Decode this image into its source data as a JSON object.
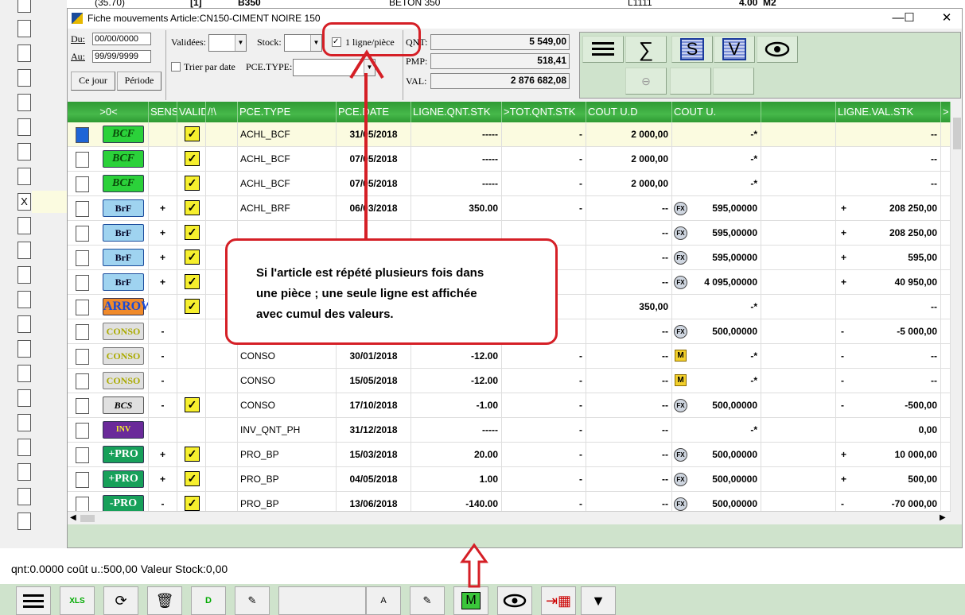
{
  "background": {
    "top_row": {
      "qty": "(35.70)",
      "code": "[1]",
      "name": "B350",
      "desc": "BETON 350",
      "ref": "L1111",
      "val": "4.00",
      "unit": "M2"
    },
    "marked_row_label": "X"
  },
  "window": {
    "title": "Fiche mouvements Article:CN150-CIMENT NOIRE 150",
    "minimize": "—",
    "maximize": "☐",
    "close": "✕"
  },
  "filters": {
    "du_label": "Du:",
    "du_value": "00/00/0000",
    "au_label": "Au:",
    "au_value": "99/99/9999",
    "ce_jour": "Ce jour",
    "periode": "Période",
    "validees_label": "Validées:",
    "stock_label": "Stock:",
    "une_ligne_label": "1 ligne/pièce",
    "une_ligne_checked": true,
    "trier_label": "Trier par date",
    "pce_type_label": "PCE.TYPE:"
  },
  "summary": {
    "qnt_label": "QNT:",
    "qnt_value": "5 549,00",
    "pmp_label": "PMP:",
    "pmp_value": "518,41",
    "val_label": "VAL:",
    "val_value": "2 876 682,08"
  },
  "toolbar": {
    "menu_icon": "hamburger-icon",
    "sum_icon": "sigma-icon",
    "s_label": "S",
    "v_label": "V",
    "eye_icon": "eye-icon",
    "zoom_icon": "zoom-out-icon"
  },
  "grid": {
    "headers": [
      ">0<",
      "SENS",
      "VALID",
      "/!\\",
      "PCE.TYPE",
      "PCE.DATE",
      "LIGNE.QNT.STK",
      ">TOT.QNT.STK",
      "COUT U.D",
      "COUT U.",
      "",
      "LIGNE.VAL.STK",
      ">"
    ],
    "rows": [
      {
        "badge": "BCF",
        "sens": "",
        "valid": true,
        "type": "ACHL_BCF",
        "date": "31/05/2018",
        "qnt": "-----",
        "tot": "-",
        "coutud": "2 000,00",
        "cout_icon": "",
        "coutu": "-*",
        "val_icon": "",
        "val": "--"
      },
      {
        "badge": "BCF",
        "sens": "",
        "valid": true,
        "type": "ACHL_BCF",
        "date": "07/05/2018",
        "qnt": "-----",
        "tot": "-",
        "coutud": "2 000,00",
        "cout_icon": "",
        "coutu": "-*",
        "val_icon": "",
        "val": "--"
      },
      {
        "badge": "BCF",
        "sens": "",
        "valid": true,
        "type": "ACHL_BCF",
        "date": "07/05/2018",
        "qnt": "-----",
        "tot": "-",
        "coutud": "2 000,00",
        "cout_icon": "",
        "coutu": "-*",
        "val_icon": "",
        "val": "--"
      },
      {
        "badge": "BrF",
        "sens": "+",
        "valid": true,
        "type": "ACHL_BRF",
        "date": "06/03/2018",
        "qnt": "350.00",
        "tot": "-",
        "coutud": "--",
        "cout_icon": "FX",
        "coutu": "595,00000",
        "val_icon": "+",
        "val": "208 250,00"
      },
      {
        "badge": "BrF",
        "sens": "+",
        "valid": true,
        "type": "",
        "date": "",
        "qnt": "",
        "tot": "",
        "coutud": "--",
        "cout_icon": "FX",
        "coutu": "595,00000",
        "val_icon": "+",
        "val": "208 250,00"
      },
      {
        "badge": "BrF",
        "sens": "+",
        "valid": true,
        "type": "",
        "date": "",
        "qnt": "",
        "tot": "",
        "coutud": "--",
        "cout_icon": "FX",
        "coutu": "595,00000",
        "val_icon": "+",
        "val": "595,00"
      },
      {
        "badge": "BrF",
        "sens": "+",
        "valid": true,
        "type": "",
        "date": "",
        "qnt": "",
        "tot": "",
        "coutud": "--",
        "cout_icon": "FX",
        "coutu": "4 095,00000",
        "val_icon": "+",
        "val": "40 950,00"
      },
      {
        "badge": "ARROW",
        "sens": "",
        "valid": true,
        "type": "",
        "date": "",
        "qnt": "",
        "tot": "",
        "coutud": "350,00",
        "cout_icon": "",
        "coutu": "-*",
        "val_icon": "",
        "val": "--"
      },
      {
        "badge": "CONSO",
        "sens": "-",
        "valid": false,
        "type": "",
        "date": "",
        "qnt": "",
        "tot": "",
        "coutud": "--",
        "cout_icon": "FX",
        "coutu": "500,00000",
        "val_icon": "-",
        "val": "-5 000,00"
      },
      {
        "badge": "CONSO",
        "sens": "-",
        "valid": false,
        "type": "CONSO",
        "date": "30/01/2018",
        "qnt": "-12.00",
        "tot": "-",
        "coutud": "--",
        "cout_icon": "M",
        "coutu": "-*",
        "val_icon": "-",
        "val": "--"
      },
      {
        "badge": "CONSO",
        "sens": "-",
        "valid": false,
        "type": "CONSO",
        "date": "15/05/2018",
        "qnt": "-12.00",
        "tot": "-",
        "coutud": "--",
        "cout_icon": "M",
        "coutu": "-*",
        "val_icon": "-",
        "val": "--"
      },
      {
        "badge": "BCS",
        "sens": "-",
        "valid": true,
        "type": "CONSO",
        "date": "17/10/2018",
        "qnt": "-1.00",
        "tot": "-",
        "coutud": "--",
        "cout_icon": "FX",
        "coutu": "500,00000",
        "val_icon": "-",
        "val": "-500,00"
      },
      {
        "badge": "INV",
        "sens": "",
        "valid": false,
        "type": "INV_QNT_PH",
        "date": "31/12/2018",
        "qnt": "-----",
        "tot": "-",
        "coutud": "--",
        "cout_icon": "",
        "coutu": "-*",
        "val_icon": "",
        "val": "0,00"
      },
      {
        "badge": "+PRO",
        "sens": "+",
        "valid": true,
        "type": "PRO_BP",
        "date": "15/03/2018",
        "qnt": "20.00",
        "tot": "-",
        "coutud": "--",
        "cout_icon": "FX",
        "coutu": "500,00000",
        "val_icon": "+",
        "val": "10 000,00"
      },
      {
        "badge": "+PRO",
        "sens": "+",
        "valid": true,
        "type": "PRO_BP",
        "date": "04/05/2018",
        "qnt": "1.00",
        "tot": "-",
        "coutud": "--",
        "cout_icon": "FX",
        "coutu": "500,00000",
        "val_icon": "+",
        "val": "500,00"
      },
      {
        "badge": "-PRO",
        "sens": "-",
        "valid": true,
        "type": "PRO_BP",
        "date": "13/06/2018",
        "qnt": "-140.00",
        "tot": "-",
        "coutud": "--",
        "cout_icon": "FX",
        "coutu": "500,00000",
        "val_icon": "-",
        "val": "-70 000,00"
      }
    ]
  },
  "callout": {
    "line1": "Si l'article est répété plusieurs fois  dans",
    "line2": "une pièce ; une seule ligne est affichée",
    "line3": "avec cumul des valeurs."
  },
  "status": {
    "text": "qnt:0.0000  coût u.:500,00  Valeur Stock:0,00"
  },
  "bottom_toolbar": {
    "xls": "XLS",
    "d_label": "D",
    "a_label": "A",
    "m_label": "M"
  },
  "colors": {
    "header_green": "#3aa83f",
    "panel_green": "#cfe3cc",
    "callout_red": "#d51f26",
    "valid_yellow": "#f6ef2e"
  }
}
